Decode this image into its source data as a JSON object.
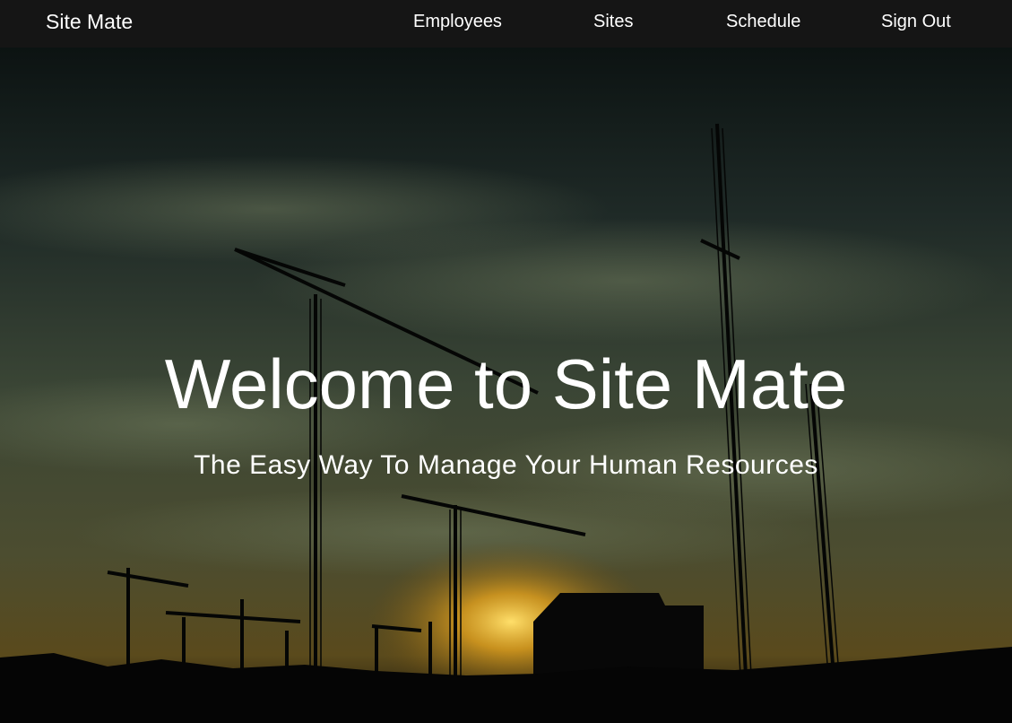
{
  "navbar": {
    "brand": "Site Mate",
    "links": [
      {
        "label": "Employees"
      },
      {
        "label": "Sites"
      },
      {
        "label": "Schedule"
      },
      {
        "label": "Sign Out"
      }
    ]
  },
  "hero": {
    "title": "Welcome to Site Mate",
    "subtitle": "The Easy Way To Manage Your Human Resources",
    "background_image": "construction-cranes-sunset-photo"
  },
  "colors": {
    "navbar_bg": "#151515",
    "text": "#ffffff",
    "sky_dark": "#0e1514",
    "sky_mid": "#3d4837",
    "sunset_glow": "#d9a21c"
  }
}
